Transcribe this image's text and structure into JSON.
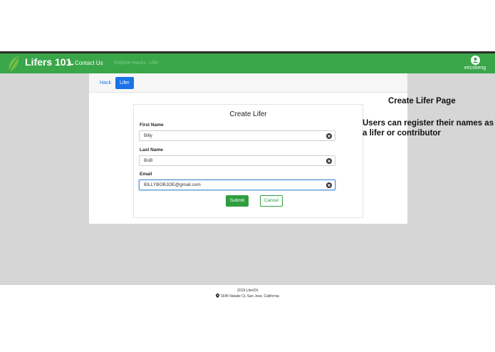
{
  "navbar": {
    "brand": "Lifers 101",
    "contact_label": "Contact Us",
    "explore_label": "Explore Hacks",
    "lifer_label": "Lifer",
    "username": "ericsheng"
  },
  "tabs": [
    {
      "label": "Hack",
      "active": false
    },
    {
      "label": "Lifer",
      "active": true
    }
  ],
  "form": {
    "title": "Create Lifer",
    "fields": [
      {
        "label": "First Name",
        "value": "Billy"
      },
      {
        "label": "Last Name",
        "value": "BoB"
      },
      {
        "label": "Email",
        "value": "BILLYBOBJOE@gmail.com"
      }
    ],
    "submit_label": "Submit",
    "cancel_label": "Cancel"
  },
  "annotation": {
    "heading": "Create Lifer Page",
    "description": "Users can register their names as a lifer or contributor"
  },
  "footer": {
    "line1": "2019 LiferIOt",
    "line2": "1645 Natalie Ct, San Jose, California"
  },
  "colors": {
    "navbar": "#3aa64a",
    "primary_blue": "#1a73e8",
    "submit_green": "#2e9e3f",
    "page_gray": "#d6d6d6"
  }
}
